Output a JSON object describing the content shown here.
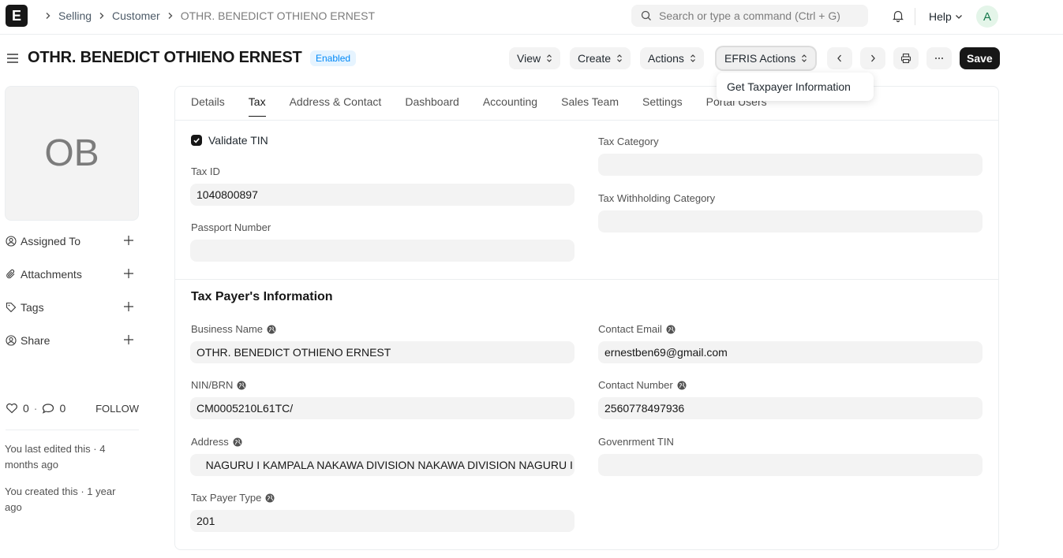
{
  "navbar": {
    "logo_letter": "E",
    "breadcrumbs": [
      "Selling",
      "Customer",
      "OTHR. BENEDICT OTHIENO ERNEST"
    ],
    "search_placeholder": "Search or type a command (Ctrl + G)",
    "help_label": "Help",
    "user_initial": "A"
  },
  "page": {
    "title": "OTHR. BENEDICT OTHIENO ERNEST",
    "status": "Enabled",
    "buttons": {
      "view": "View",
      "create": "Create",
      "actions": "Actions",
      "efris": "EFRIS Actions",
      "save": "Save"
    },
    "dropdown_item": "Get Taxpayer Information"
  },
  "sidebar": {
    "avatar_initials": "OB",
    "items": [
      "Assigned To",
      "Attachments",
      "Tags",
      "Share"
    ],
    "likes": "0",
    "comments": "0",
    "follow": "FOLLOW",
    "last_edited": "You last edited this · 4 months ago",
    "created": "You created this · 1 year ago"
  },
  "tabs": [
    "Details",
    "Tax",
    "Address & Contact",
    "Dashboard",
    "Accounting",
    "Sales Team",
    "Settings",
    "Portal Users"
  ],
  "tax": {
    "validate_tin_label": "Validate TIN",
    "tax_id_label": "Tax ID",
    "tax_id": "1040800897",
    "passport_label": "Passport Number",
    "passport": "",
    "tax_category_label": "Tax Category",
    "tax_category": "",
    "withholding_label": "Tax Withholding Category",
    "withholding": ""
  },
  "taxpayer": {
    "section_title": "Tax Payer's Information",
    "business_name_label": "Business Name",
    "business_name": "OTHR. BENEDICT OTHIENO ERNEST",
    "nin_label": "NIN/BRN",
    "nin": "CM0005210L61TC/",
    "address_label": "Address",
    "address": "   NAGURU I KAMPALA NAKAWA DIVISION NAKAWA DIVISION NAGURU I",
    "payer_type_label": "Tax Payer Type",
    "payer_type": "201",
    "email_label": "Contact Email",
    "email": "ernestben69@gmail.com",
    "contact_label": "Contact Number",
    "contact": "2560778497936",
    "gov_tin_label": "Govenrment TIN",
    "gov_tin": ""
  }
}
